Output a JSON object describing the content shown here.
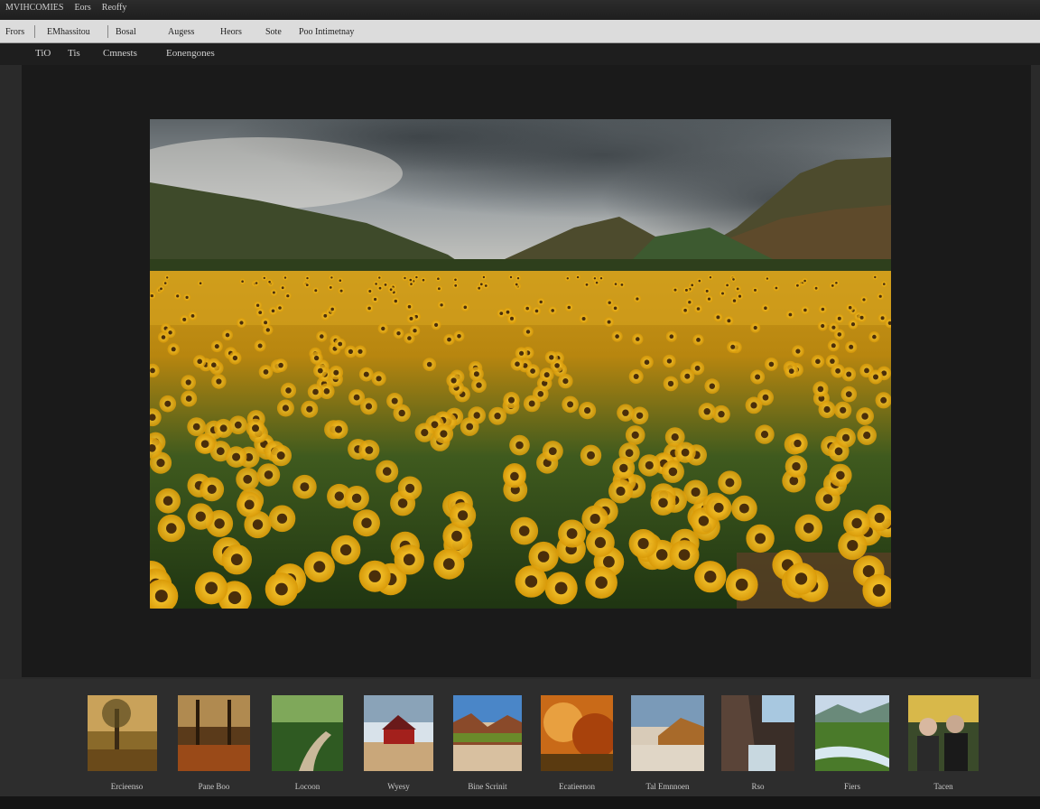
{
  "titlebar": {
    "menu": [
      "MVIHCOMIES",
      "Eors",
      "Reoffy"
    ]
  },
  "toolbar": {
    "items": [
      "Frors",
      "EMhassitou",
      "Bosal",
      "Augess",
      "Heors",
      "Sote",
      "Poo Intimetnay"
    ]
  },
  "tabs": [
    "TiO",
    "Tis",
    "Cmnests",
    "Eonengones"
  ],
  "filmstrip": {
    "labels": [
      "Ercieenso",
      "Pane Boo",
      "Locoon",
      "Wyesy",
      "Bine Scrinit",
      "Ecatieenon",
      "Tal Emnnoen",
      "Rso",
      "Fiers",
      "Tacen"
    ]
  }
}
